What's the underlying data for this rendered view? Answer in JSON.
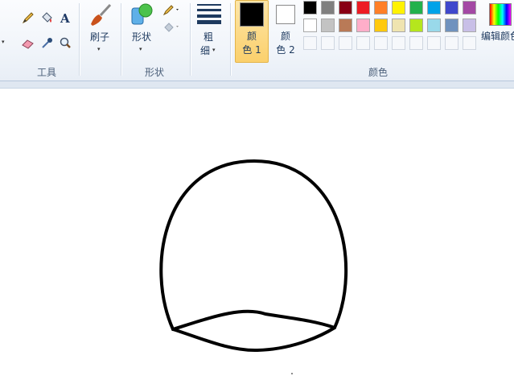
{
  "ribbon": {
    "tools": {
      "group_label": "工具",
      "icons": [
        "pencil-icon",
        "fill-bucket-icon",
        "text-icon",
        "eraser-icon",
        "color-picker-icon",
        "magnifier-icon"
      ]
    },
    "brushes": {
      "label_line1": "刷子"
    },
    "shapes": {
      "label_line1": "形状",
      "group_label": "形状"
    },
    "size": {
      "label_line1": "粗",
      "label_line2": "细"
    },
    "color1": {
      "label_line1": "颜",
      "label_line2": "色 1",
      "value": "#000000"
    },
    "color2": {
      "label_line1": "颜",
      "label_line2": "色 2",
      "value": "#ffffff"
    },
    "colors": {
      "group_label": "颜色",
      "palette_row1": [
        "#000000",
        "#7f7f7f",
        "#880015",
        "#ed1c24",
        "#ff7f27",
        "#fff200",
        "#22b14c",
        "#00a2e8",
        "#3f48cc",
        "#a349a4"
      ],
      "palette_row2": [
        "#ffffff",
        "#c3c3c3",
        "#b97a57",
        "#ffaec9",
        "#ffc90e",
        "#efe4b0",
        "#b5e61d",
        "#99d9ea",
        "#7092be",
        "#c8bfe7"
      ],
      "edit_colors_label": "编辑颜色"
    }
  }
}
